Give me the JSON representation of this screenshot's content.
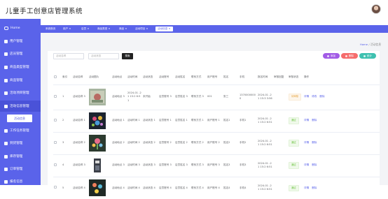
{
  "app": {
    "title": "儿童手工创意店管理系统"
  },
  "sidebar": {
    "items": [
      {
        "label": "Home",
        "icon": "home-icon"
      },
      {
        "label": "用户管理",
        "icon": "user-icon"
      },
      {
        "label": "店员管理",
        "icon": "clerk-icon"
      },
      {
        "label": "商品类型管理",
        "icon": "chart-icon"
      },
      {
        "label": "商品管理",
        "icon": "goods-icon"
      },
      {
        "label": "活动项目管理",
        "icon": "project-icon"
      },
      {
        "label": "活动信息管理",
        "icon": "activity-icon"
      },
      {
        "label": "工作任务管理",
        "icon": "task-icon"
      },
      {
        "label": "到货管理",
        "icon": "arrival-icon"
      },
      {
        "label": "库存管理",
        "icon": "stock-icon"
      },
      {
        "label": "订单管理",
        "icon": "order-icon"
      },
      {
        "label": "报名信息",
        "icon": "signup-icon"
      }
    ],
    "active_sub": "活动信息"
  },
  "tabs": [
    {
      "label": "系统首页"
    },
    {
      "label": "用户 ×"
    },
    {
      "label": "店员 ×"
    },
    {
      "label": "商品类型 ×"
    },
    {
      "label": "商品 ×"
    },
    {
      "label": "活动项目 ×"
    },
    {
      "label": "活动信息 ×"
    }
  ],
  "breadcrumb": {
    "home": "Home",
    "sep": "/",
    "current": "活动信息"
  },
  "search": {
    "field1_placeholder": "活动名称",
    "field2_placeholder": "活动状态",
    "search_label": "搜索"
  },
  "actions": {
    "add_label": "添加",
    "delete_label": "删除",
    "stats_label": "统计",
    "colors": {
      "add": "#a25ce6",
      "delete": "#f56c6c",
      "stats": "#3fc1b0"
    }
  },
  "table": {
    "columns": [
      "索引",
      "活动名称",
      "活动图片",
      "活动地点",
      "活动时间",
      "活动状态",
      "活动账号",
      "活动姓名",
      "联系方式",
      "用户账号",
      "姓名",
      "手机",
      "报名时间",
      "审核回复",
      "审核状态",
      "操作"
    ],
    "rows": [
      {
        "index": "1",
        "name": "活动名称 3",
        "place": "活动地点 3",
        "time": "2024-01 -21 15:2 6:51",
        "status": "未开始",
        "acct": "店员账号 3",
        "acct_name": "店员姓名 3",
        "contact": "联系方式 3",
        "user": "001",
        "uname": "张三",
        "phone": "13700000000",
        "apply_time": "2024-01 -21 15:3 3:56",
        "reply": "",
        "audit": "待审核",
        "audit_type": "pending"
      },
      {
        "index": "2",
        "name": "活动名称 1",
        "place": "活动地点 1",
        "time": "活动时间 1",
        "status": "活动状态 1",
        "acct": "店员账号 1",
        "acct_name": "店员姓名 1",
        "contact": "联系方式 1",
        "user": "用户账号 1",
        "uname": "姓名1",
        "phone": "手机1",
        "apply_time": "2024-01 -21 15:2 6:51",
        "reply": "",
        "audit": "通过",
        "audit_type": "ok"
      },
      {
        "index": "3",
        "name": "活动名称 2",
        "place": "活动地点 2",
        "time": "活动时间 2",
        "status": "活动状态 2",
        "acct": "店员账号 2",
        "acct_name": "店员姓名 2",
        "contact": "联系方式 2",
        "user": "用户账号 2",
        "uname": "姓名2",
        "phone": "手机2",
        "apply_time": "2024-01 -21 15:2 6:51",
        "reply": "",
        "audit": "通过",
        "audit_type": "ok"
      },
      {
        "index": "4",
        "name": "活动名称 3",
        "place": "活动地点 3",
        "time": "活动时间 3",
        "status": "活动状态 3",
        "acct": "店员账号 3",
        "acct_name": "店员姓名 3",
        "contact": "联系方式 3",
        "user": "用户账号 3",
        "uname": "姓名3",
        "phone": "手机3",
        "apply_time": "2024-01 -21 15:2 6:51",
        "reply": "",
        "audit": "通过",
        "audit_type": "ok"
      },
      {
        "index": "5",
        "name": "活动名称 4",
        "place": "活动地点 4",
        "time": "活动时间 4",
        "status": "活动状态 4",
        "acct": "店员账号 4",
        "acct_name": "店员姓名 4",
        "contact": "联系方式 4",
        "user": "用户账号 4",
        "uname": "姓名4",
        "phone": "手机4",
        "apply_time": "2024-01 -21 15:2 6:51",
        "reply": "",
        "audit": "通过",
        "audit_type": "ok"
      }
    ],
    "op_labels": {
      "view": "详情",
      "edit": "修改",
      "delete": "删除"
    }
  }
}
